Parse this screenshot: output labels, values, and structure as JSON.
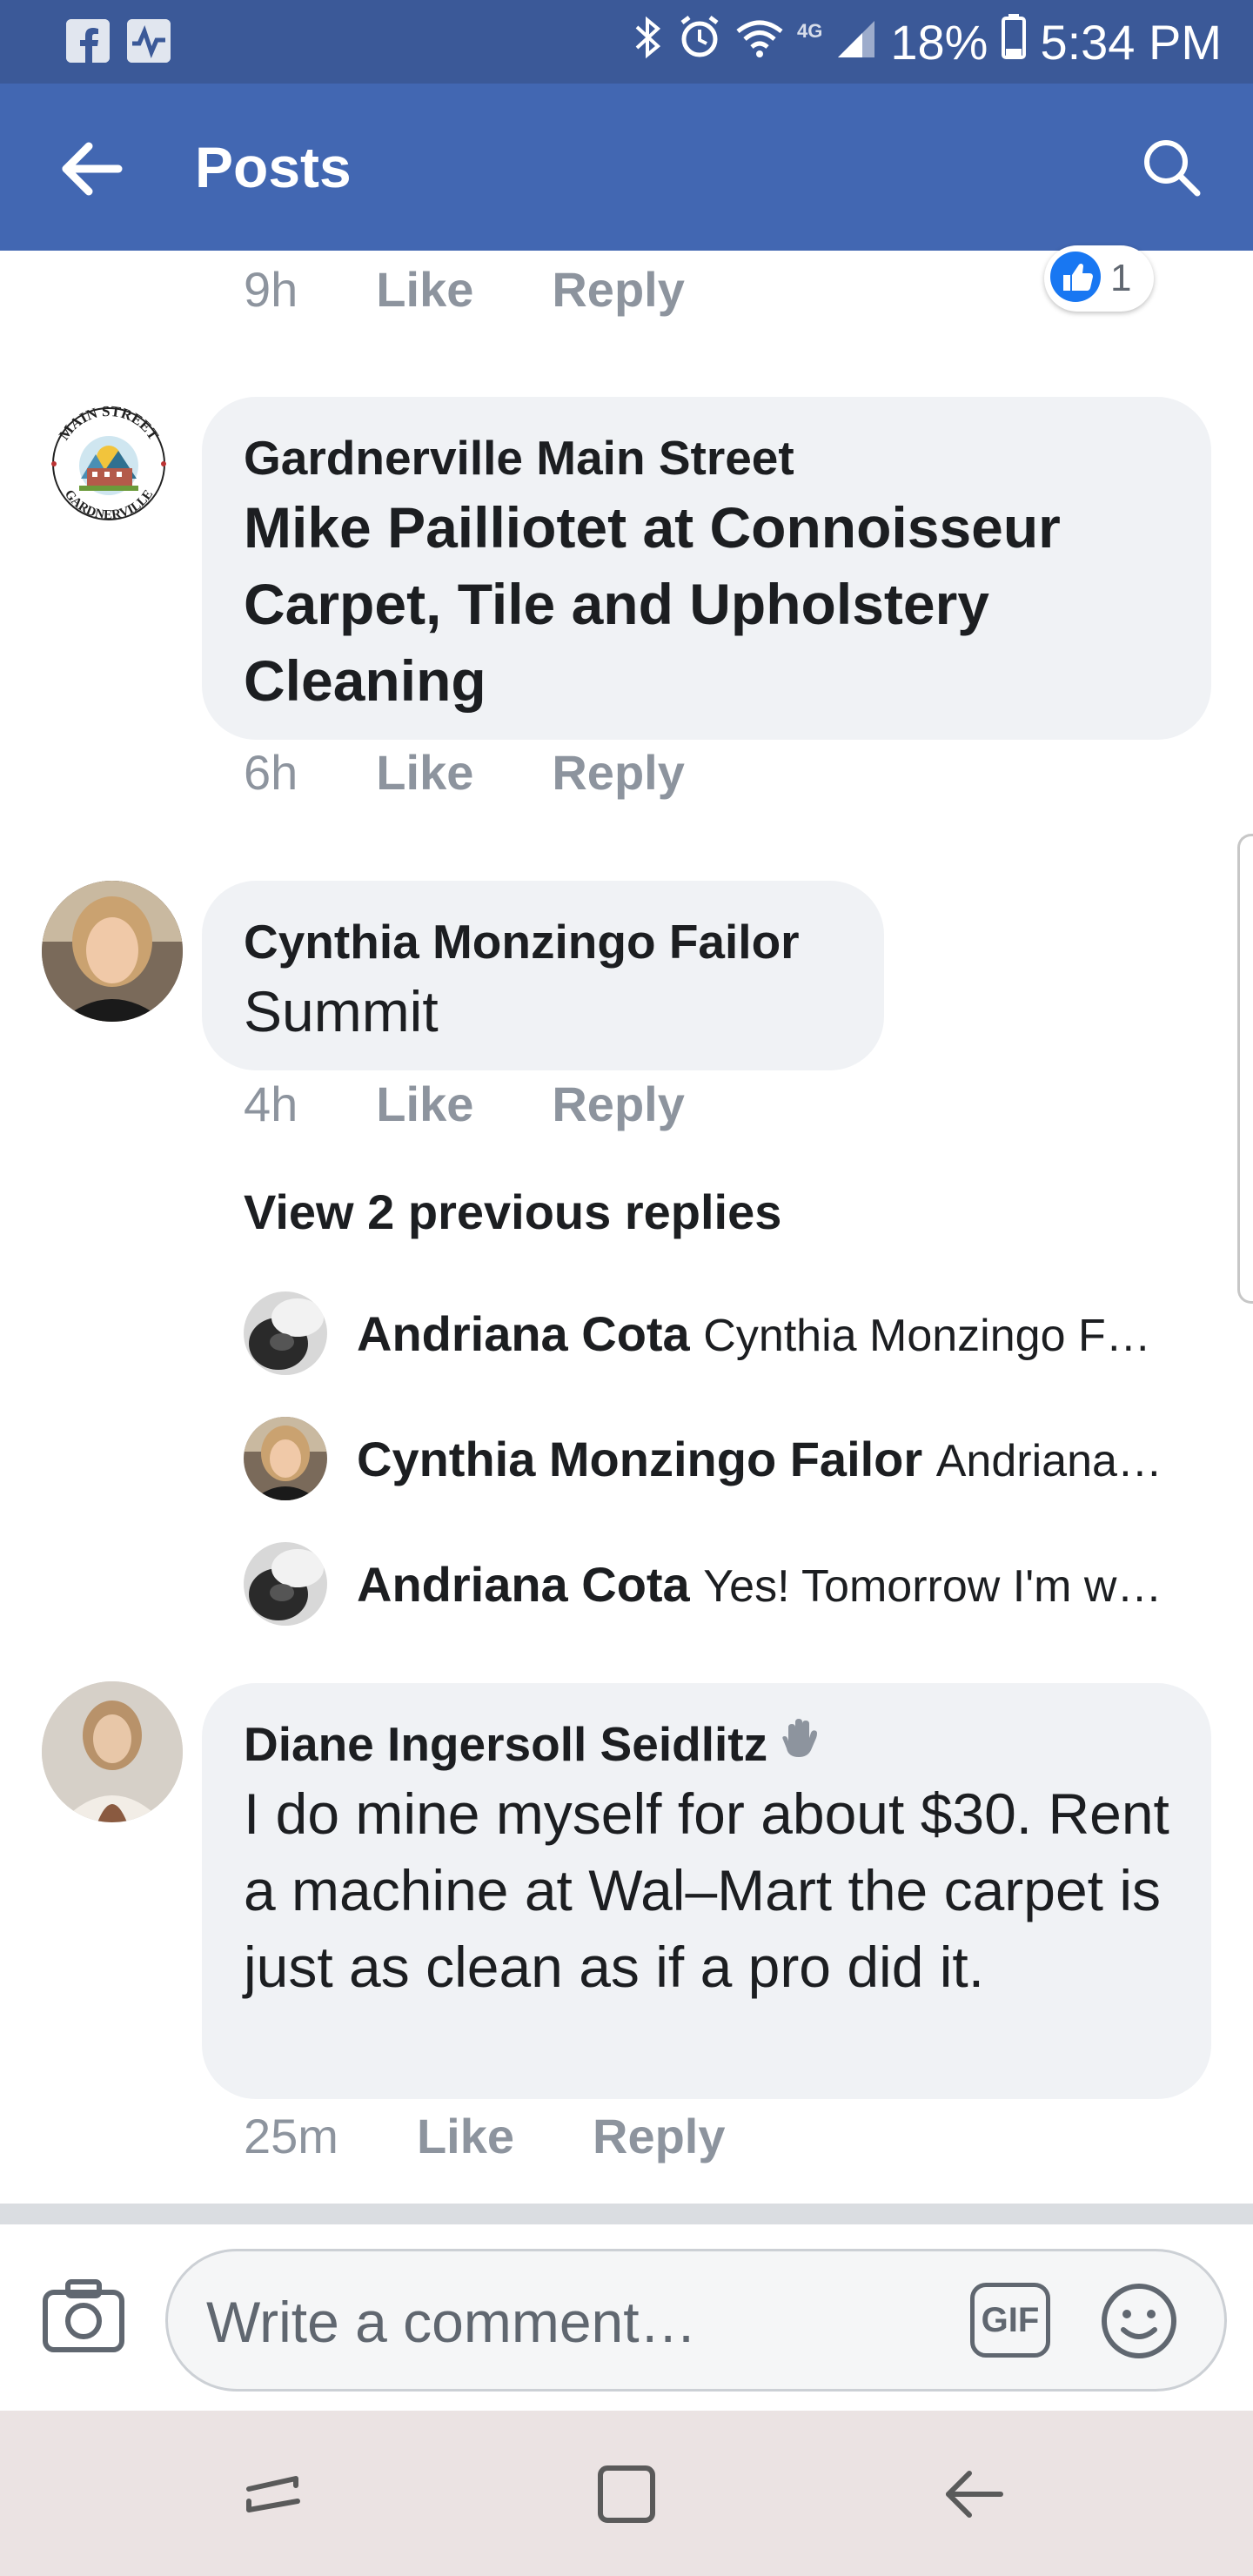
{
  "status_bar": {
    "network": "4G",
    "battery": "18%",
    "time": "5:34 PM"
  },
  "header": {
    "title": "Posts"
  },
  "reaction": {
    "count": "1"
  },
  "actions": {
    "like": "Like",
    "reply": "Reply"
  },
  "comments": [
    {
      "time": "9h"
    },
    {
      "author": "Gardnerville Main Street",
      "text": "Mike Pailliotet at Connoisseur Carpet, Tile and Upholstery Cleaning",
      "time": "6h"
    },
    {
      "author": "Cynthia Monzingo Failor",
      "text": "Summit",
      "time": "4h"
    },
    {
      "author": "Diane Ingersoll Seidlitz",
      "text": "I do mine myself for about $30. Rent a machine at Wal–Mart the carpet is just as clean as if a pro did it.",
      "time": "25m"
    }
  ],
  "logo": {
    "top_text": "MAIN STREET",
    "bottom_text": "GARDNERVILLE"
  },
  "replies": {
    "view_previous": "View 2 previous replies",
    "items": [
      {
        "author": "Andriana Cota",
        "snippet": "Cynthia Monzingo F…"
      },
      {
        "author": "Cynthia Monzingo Failor",
        "snippet": "Andriana…"
      },
      {
        "author": "Andriana Cota",
        "snippet": "Yes! Tomorrow I'm w…"
      }
    ]
  },
  "composer": {
    "placeholder": "Write a comment…",
    "gif_label": "GIF"
  },
  "colors": {
    "status_bar": "#3b5998",
    "header": "#4267b2",
    "like_blue": "#1877f2",
    "bubble": "#f0f2f5",
    "meta_gray": "#8d949e"
  }
}
